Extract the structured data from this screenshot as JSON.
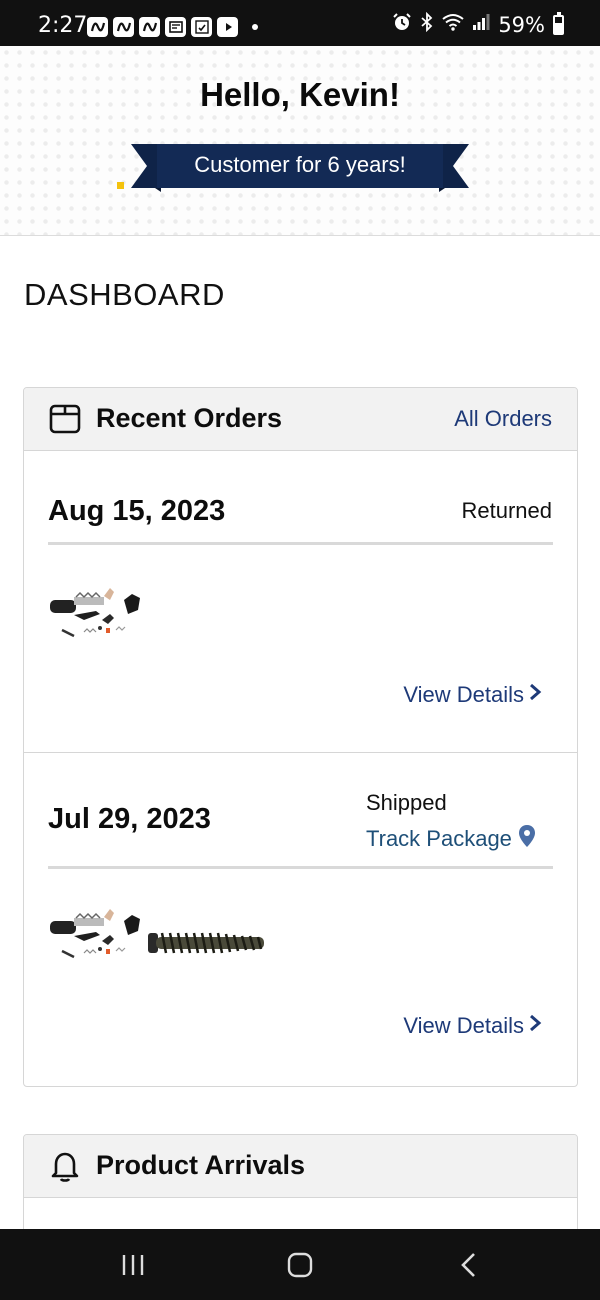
{
  "status_bar": {
    "time": "2:27",
    "notification_icons": [
      "app-n-icon",
      "app-n-icon",
      "app-n-icon",
      "news-icon",
      "calendar-icon",
      "youtube-icon"
    ],
    "battery_percent": "59%",
    "battery_level": 0.59
  },
  "greeting": {
    "hello": "Hello, Kevin!",
    "banner": "Customer for 6 years!",
    "banner_color": "#132a55"
  },
  "dashboard": {
    "title": "DASHBOARD"
  },
  "recent_orders": {
    "title": "Recent Orders",
    "all_orders_label": "All Orders",
    "orders": [
      {
        "date": "Aug 15, 2023",
        "status": "Returned",
        "products": [
          "parts-kit"
        ],
        "view_details": "View Details"
      },
      {
        "date": "Jul 29, 2023",
        "status": "Shipped",
        "track_label": "Track Package",
        "products": [
          "parts-kit",
          "recoil-spring"
        ],
        "view_details": "View Details"
      }
    ]
  },
  "product_arrivals": {
    "title": "Product Arrivals"
  },
  "colors": {
    "link": "#1e3a78",
    "header_bg": "#f2f2f2"
  }
}
